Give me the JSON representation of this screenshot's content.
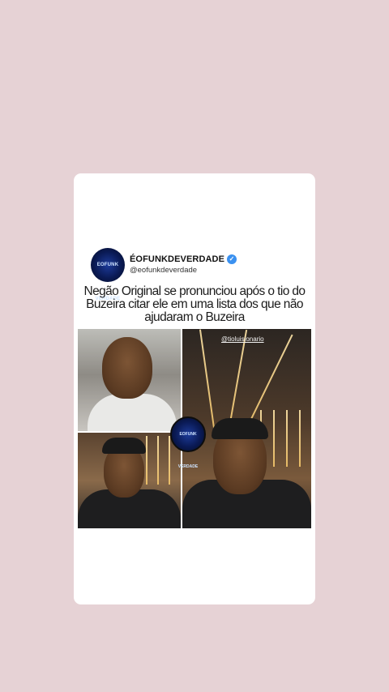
{
  "post": {
    "account_name": "ÉOFUNKDEVERDADE",
    "handle": "@eofunkdeverdade",
    "avatar_text": "EOFUNK VERDADE",
    "verified_icon": "verified-badge-icon",
    "headline": "Negão Original se pronunciou após o tio do Buzeira citar ele em uma lista dos que não ajudaram o Buzeira"
  },
  "media": {
    "video_tag": "@tioluisionario",
    "center_badge_text": "EOFUNK VERDADE"
  },
  "colors": {
    "background": "#e6d2d5",
    "card": "#ffffff",
    "verified": "#3b91f0"
  }
}
